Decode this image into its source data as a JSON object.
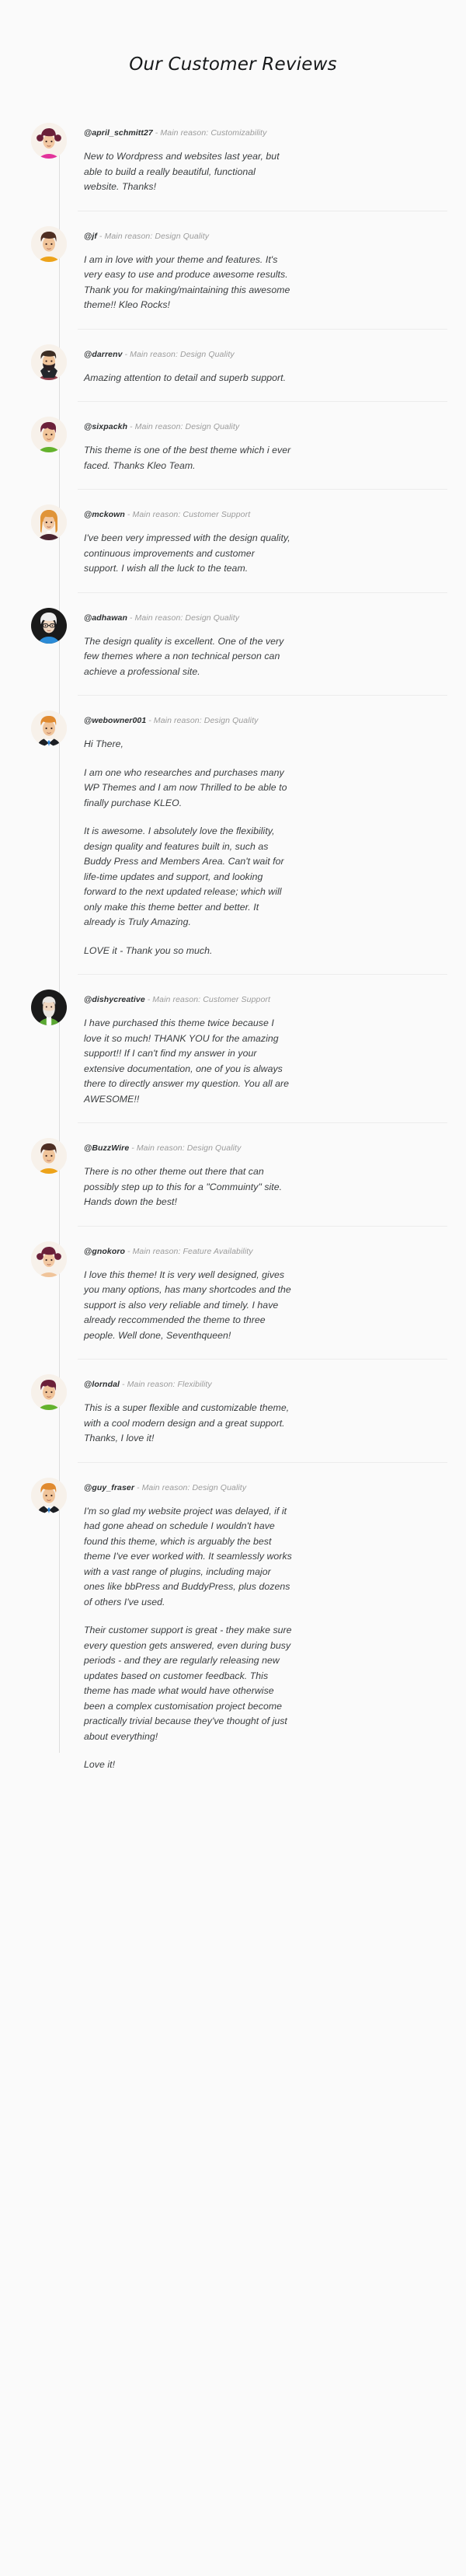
{
  "page": {
    "title": "Our Customer Reviews",
    "background_color": "#fafafa",
    "accent_color": "#dddddd",
    "handle_color": "#2b2e30",
    "reason_color": "#9b9b9b",
    "body_text_color": "#3a3d3f"
  },
  "reviews": [
    {
      "handle": "@april_schmitt27",
      "reason": "- Main reason: Customizability",
      "avatar": "avatar-girl-pigtails-pink",
      "paragraphs": [
        "New to Wordpress and websites last year, but able to build a really beautiful, functional website. Thanks!"
      ]
    },
    {
      "handle": "@jf",
      "reason": "- Main reason: Design Quality",
      "avatar": "avatar-man-orange-shirt",
      "paragraphs": [
        "I am in love with your theme and features. It's very easy to use and produce awesome results. Thank you for making/maintaining this awesome theme!! Kleo Rocks!"
      ]
    },
    {
      "handle": "@darrenv",
      "reason": "- Main reason: Design Quality",
      "avatar": "avatar-man-beard-maroon",
      "paragraphs": [
        "Amazing attention to detail and superb support."
      ]
    },
    {
      "handle": "@sixpackh",
      "reason": "- Main reason: Design Quality",
      "avatar": "avatar-man-green-shirt",
      "paragraphs": [
        "This theme is one of the best theme which i ever faced. Thanks Kleo Team."
      ]
    },
    {
      "handle": "@mckown",
      "reason": "- Main reason: Customer Support",
      "avatar": "avatar-woman-ginger-hair",
      "paragraphs": [
        "I've been very impressed with the design quality, continuous improvements and customer support. I wish all the luck to the team."
      ]
    },
    {
      "handle": "@adhawan",
      "reason": "- Main reason: Design Quality",
      "avatar": "avatar-woman-white-hair-glasses",
      "paragraphs": [
        "The design quality is excellent. One of the very few themes where a non technical person can achieve a professional site."
      ]
    },
    {
      "handle": "@webowner001",
      "reason": "- Main reason: Design Quality",
      "avatar": "avatar-man-suit-tie",
      "paragraphs": [
        "Hi There,",
        "I am one who researches and purchases many WP Themes and I am now Thrilled to be able to finally purchase KLEO.",
        "It is awesome. I absolutely love the flexibility, design quality and features built in, such as Buddy Press and Members Area. Can't wait for life-time updates and support, and looking forward to the next updated release; which will only make this theme better and better. It already is Truly Amazing.",
        "LOVE it - Thank you so much."
      ]
    },
    {
      "handle": "@dishycreative",
      "reason": "- Main reason: Customer Support",
      "avatar": "avatar-man-bald-beard-green",
      "paragraphs": [
        "I have purchased this theme twice because I love it so much! THANK YOU for the amazing support!! If I can't find my answer in your extensive documentation, one of you is always there to directly answer my question. You all are AWESOME!!"
      ]
    },
    {
      "handle": "@BuzzWire",
      "reason": "- Main reason: Design Quality",
      "avatar": "avatar-man-orange-shirt",
      "paragraphs": [
        "There is no other theme out there that can possibly step up to this for a \"Commuinty\" site. Hands down the best!"
      ]
    },
    {
      "handle": "@gnokoro",
      "reason": "- Main reason: Feature Availability",
      "avatar": "avatar-girl-pigtails-plain",
      "paragraphs": [
        "I love this theme! It is very well designed, gives you many options, has many shortcodes and the support is also very reliable and timely. I have already reccommended the theme to three people. Well done, Seventhqueen!"
      ]
    },
    {
      "handle": "@lorndal",
      "reason": "- Main reason: Flexibility",
      "avatar": "avatar-man-green-shirt",
      "paragraphs": [
        "This is a super flexible and customizable theme, with a cool modern design and a great support. Thanks, I love it!"
      ]
    },
    {
      "handle": "@guy_fraser",
      "reason": "- Main reason: Design Quality",
      "avatar": "avatar-man-suit-tie",
      "paragraphs": [
        "I'm so glad my website project was delayed, if it had gone ahead on schedule I wouldn't have found this theme, which is arguably the best theme I've ever worked with. It seamlessly works with a vast range of plugins, including major ones like bbPress and BuddyPress, plus dozens of others I've used.",
        "Their customer support is great - they make sure every question gets answered, even during busy periods - and they are regularly releasing new updates based on customer feedback. This theme has made what would have otherwise been a complex customisation project become practically trivial because they've thought of just about everything!",
        "Love it!"
      ]
    }
  ]
}
